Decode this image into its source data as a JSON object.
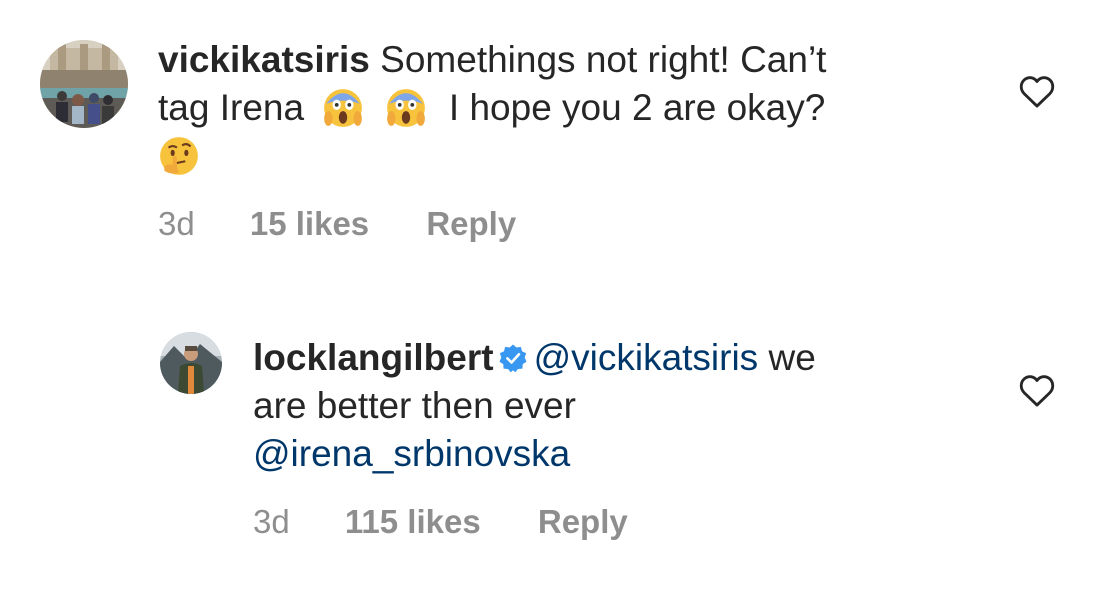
{
  "comments": [
    {
      "username": "vickikatsiris",
      "text_line1": "Somethings not right! Can’t",
      "text_line2_pre": "tag Irena",
      "text_line2_post": "I hope you 2 are okay?",
      "emoji_1": "face-screaming-in-fear",
      "emoji_2": "face-screaming-in-fear",
      "emoji_3": "thinking-face",
      "time": "3d",
      "likes": "15 likes",
      "reply_label": "Reply",
      "verified": false
    },
    {
      "username": "locklangilbert",
      "mention_1": "@vickikatsiris",
      "text_line1_post": "we",
      "text_line2": "are better then ever",
      "mention_2": "@irena_srbinovska",
      "time": "3d",
      "likes": "115 likes",
      "reply_label": "Reply",
      "verified": true
    }
  ],
  "colors": {
    "text": "#262626",
    "meta": "#8e8e8e",
    "mention": "#00376b",
    "verified": "#3897f0"
  },
  "icons": {
    "like": "heart-outline-icon",
    "verified": "verified-badge-icon"
  }
}
